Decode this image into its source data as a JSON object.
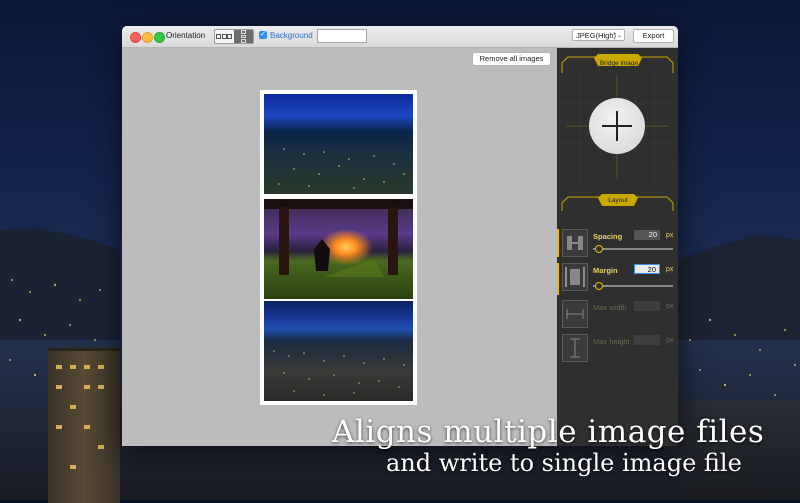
{
  "window": {
    "title_controls": {
      "orientation_label": "Orientation",
      "orientation_options": [
        "horizontal",
        "vertical"
      ],
      "orientation_selected": "vertical",
      "background_checked": true,
      "background_label": "Background",
      "background_color": "#ffffff",
      "format_value": "JPEG(High)",
      "export_label": "Export"
    },
    "canvas": {
      "remove_all_label": "Remove all images",
      "images": [
        {
          "name": "city-night-blue-sky"
        },
        {
          "name": "pavilion-sunset"
        },
        {
          "name": "city-dusk-panorama"
        }
      ]
    },
    "panel": {
      "bridge_label": "Bridge image",
      "layout_label": "Layout",
      "rows": [
        {
          "label": "Spacing",
          "value": "20",
          "unit": "px",
          "enabled": true
        },
        {
          "label": "Margin",
          "value": "20",
          "unit": "px",
          "enabled": true
        },
        {
          "label": "Max width",
          "value": "",
          "unit": "px",
          "enabled": false
        },
        {
          "label": "Max height",
          "value": "",
          "unit": "px",
          "enabled": false
        }
      ]
    }
  },
  "caption": {
    "line1": "Aligns multiple image files",
    "line2": "and write to single image file"
  },
  "colors": {
    "accent_yellow": "#e6c000",
    "focus_blue": "#3a8ef0",
    "panel_bg": "#2f2f2f",
    "canvas_bg": "#bcbcbc"
  }
}
